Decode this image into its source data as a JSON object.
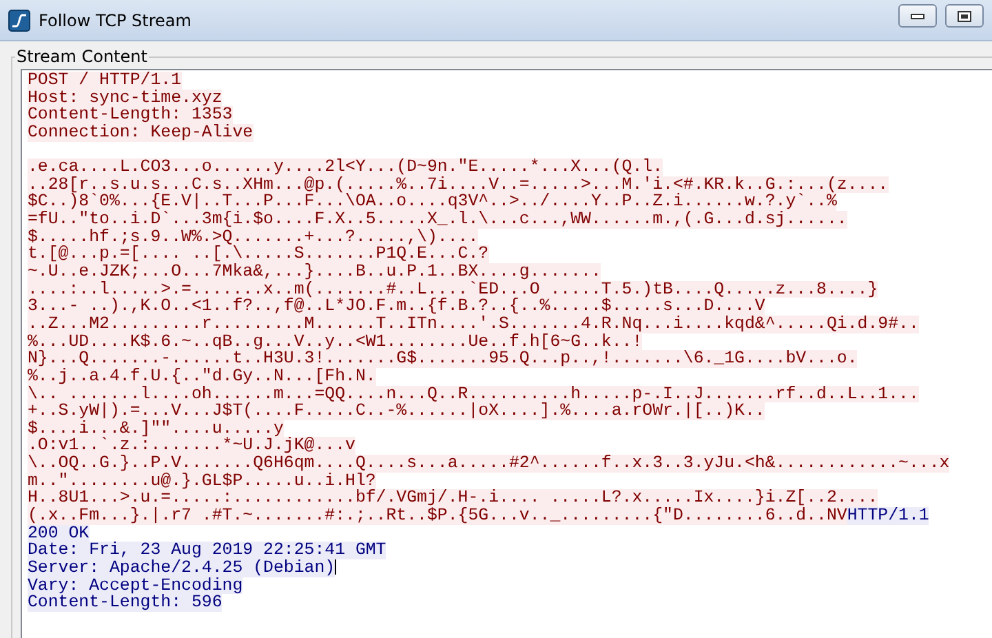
{
  "window": {
    "title": "Follow TCP Stream"
  },
  "group": {
    "label": "Stream Content"
  },
  "stream": [
    {
      "kind": "text",
      "segments": [
        {
          "text": "POST / HTTP/1.1",
          "from_server": false
        }
      ]
    },
    {
      "kind": "text",
      "segments": [
        {
          "text": "Host: sync-time.xyz",
          "from_server": false
        }
      ]
    },
    {
      "kind": "text",
      "segments": [
        {
          "text": "Content-Length: 1353",
          "from_server": false
        }
      ]
    },
    {
      "kind": "text",
      "segments": [
        {
          "text": "Connection: Keep-Alive",
          "from_server": false
        }
      ]
    },
    {
      "kind": "blank"
    },
    {
      "kind": "text",
      "segments": [
        {
          "text": ".e.ca....L.CO3...o......y....2l<Y...(D~9n.\"E.....*...X...(Q.l.",
          "from_server": false
        }
      ]
    },
    {
      "kind": "text",
      "segments": [
        {
          "text": "..28[r..s.u.s...C.s..XHm...@p.(.....%..7i....V..=.....>...M.'i.<#.KR.k..G.:...(z....",
          "from_server": false
        }
      ]
    },
    {
      "kind": "text",
      "segments": [
        {
          "text": "$C..)8`0%...{E.V|..T...P...F...\\OA..o....q3V^..>../....Y..P..Z.i......w.?.y`..%",
          "from_server": false
        }
      ]
    },
    {
      "kind": "text",
      "segments": [
        {
          "text": "=fU..\"to..i.D`...3m{i.$o....F.X..5.....X_.l.\\...c...,WW......m.,(.G...d.sj......",
          "from_server": false
        }
      ]
    },
    {
      "kind": "text",
      "segments": [
        {
          "text": "$.....hf.;s.9..W%.>Q.......+...?.....,\\)....",
          "from_server": false
        }
      ]
    },
    {
      "kind": "text",
      "segments": [
        {
          "text": "t.[@...p.=[.... ..[.\\.....S.......P1Q.E...C.?",
          "from_server": false
        }
      ]
    },
    {
      "kind": "text",
      "segments": [
        {
          "text": "~.U..e.JZK;...O...7Mka&,...}....B..u.P.1..BX....g.......",
          "from_server": false
        }
      ]
    },
    {
      "kind": "text",
      "segments": [
        {
          "text": "....:..l.....>.=.......x..m(.......#..L....`ED...O .....T.5.)tB....Q.....z...8....}",
          "from_server": false
        }
      ]
    },
    {
      "kind": "text",
      "segments": [
        {
          "text": "3...- ..).,K.O..<1..f?..,f@..L*JO.F.m..{f.B.?..{..%.....$.....s...D....V",
          "from_server": false
        }
      ]
    },
    {
      "kind": "text",
      "segments": [
        {
          "text": "..Z...M2.........r.........M......T..ITn....'.S.......4.R.Nq...i....kqd&^.....Qi.d.9#..",
          "from_server": false
        }
      ]
    },
    {
      "kind": "text",
      "segments": [
        {
          "text": "%...UD....K$.6.~..qB..g...V..y..<W1........Ue..f.h[6~G..k..!",
          "from_server": false
        }
      ]
    },
    {
      "kind": "text",
      "segments": [
        {
          "text": "N}...Q.......-......t..H3U.3!.......G$.......95.Q...p..,!.......\\6._1G....bV...o.",
          "from_server": false
        }
      ]
    },
    {
      "kind": "text",
      "segments": [
        {
          "text": "%..j..a.4.f.U.{..\"d.Gy..N...[Fh.N.",
          "from_server": false
        }
      ]
    },
    {
      "kind": "text",
      "segments": [
        {
          "text": "\\.. .......l....oh......m...=QQ....n...Q..R..........h.....p-.I..J.......rf..d..L..1...",
          "from_server": false
        }
      ]
    },
    {
      "kind": "text",
      "segments": [
        {
          "text": "+..S.yW|).=...V...J$T(....F.....C..-%......|oX....].%....a.rOWr.|[..)K..",
          "from_server": false
        }
      ]
    },
    {
      "kind": "text",
      "segments": [
        {
          "text": "$....i...&.]\"\"....u.....y",
          "from_server": false
        }
      ]
    },
    {
      "kind": "text",
      "segments": [
        {
          "text": ".O:v1..`.z.:.......*~U.J.jK@...v",
          "from_server": false
        }
      ]
    },
    {
      "kind": "text",
      "segments": [
        {
          "text": "\\..OQ..G.}..P.V.......Q6H6qm....Q....s...a.....#2^......f..x.3..3.yJu.<h&............~...x",
          "from_server": false
        }
      ]
    },
    {
      "kind": "text",
      "segments": [
        {
          "text": "m..\"........u@.}.GL$P.....u..i.Hl?",
          "from_server": false
        }
      ]
    },
    {
      "kind": "text",
      "segments": [
        {
          "text": "H..8U1...>.u.=.....:............bf/.VGmj/.H-.i.... .....L?.x.....Ix....}i.Z[..2....",
          "from_server": false
        }
      ]
    },
    {
      "kind": "text",
      "segments": [
        {
          "text": "(.x..Fm...}.|.r7 .#T.~.......#:.;..Rt..$P.{5G...v.._.........{\"D........6..d..NV",
          "from_server": false
        },
        {
          "text": "HTTP/1.1",
          "from_server": true
        }
      ]
    },
    {
      "kind": "text",
      "segments": [
        {
          "text": "200 OK",
          "from_server": true
        }
      ]
    },
    {
      "kind": "text",
      "segments": [
        {
          "text": "Date: Fri, 23 Aug 2019 22:25:41 GMT",
          "from_server": true
        }
      ]
    },
    {
      "kind": "text",
      "segments": [
        {
          "text": "Server: Apache/2.4.25 (Debian)",
          "from_server": true
        }
      ]
    },
    {
      "kind": "text",
      "segments": [
        {
          "text": "Vary: Accept-Encoding",
          "from_server": true
        }
      ]
    },
    {
      "kind": "text",
      "segments": [
        {
          "text": "Content-Length: 596",
          "from_server": true
        }
      ]
    }
  ]
}
